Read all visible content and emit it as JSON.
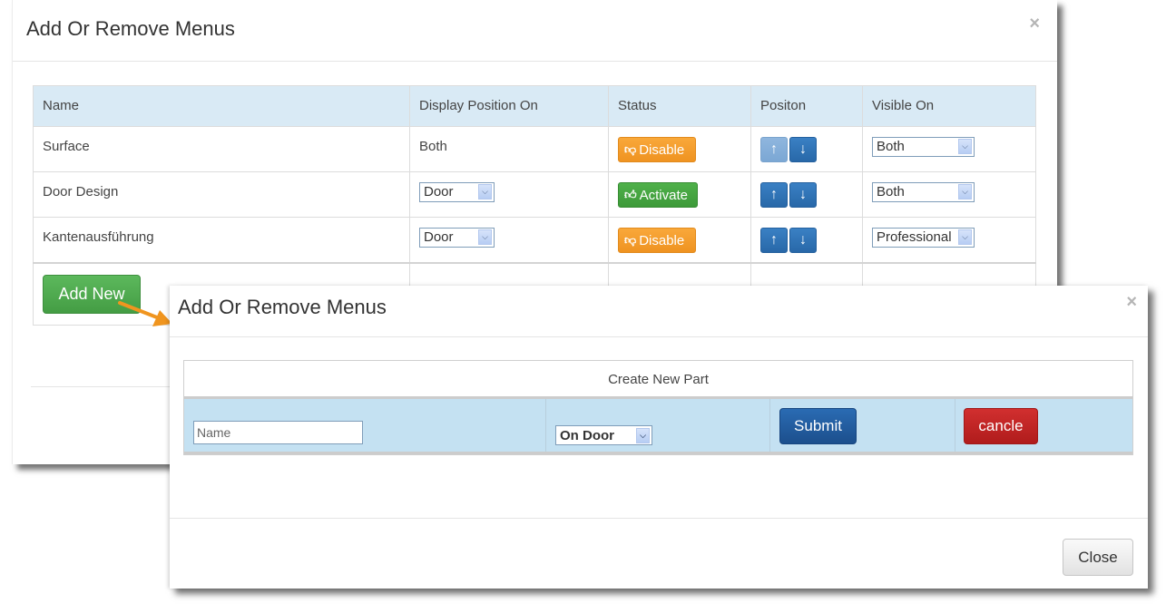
{
  "back_modal": {
    "title": "Add Or Remove Menus",
    "close_glyph": "×",
    "columns": [
      "Name",
      "Display Position On",
      "Status",
      "Positon",
      "Visible On"
    ],
    "rows": [
      {
        "name": "Surface",
        "display_position": "Both",
        "display_position_is_select": false,
        "status": "Disable",
        "status_type": "disable",
        "up_enabled": false,
        "down_enabled": true,
        "visible_on": "Both"
      },
      {
        "name": "Door Design",
        "display_position": "Door",
        "display_position_is_select": true,
        "status": "Activate",
        "status_type": "activate",
        "up_enabled": true,
        "down_enabled": true,
        "visible_on": "Both"
      },
      {
        "name": "Kantenausführung",
        "display_position": "Door",
        "display_position_is_select": true,
        "status": "Disable",
        "status_type": "disable",
        "up_enabled": true,
        "down_enabled": true,
        "visible_on": "Professional"
      }
    ],
    "add_new_label": "Add New",
    "icons": {
      "up": "↑",
      "down": "↓",
      "thumbs_down": "👎",
      "thumbs_up": "👍",
      "dropdown": "⌄"
    }
  },
  "front_modal": {
    "title": "Add Or Remove Menus",
    "close_glyph": "×",
    "table_header": "Create New Part",
    "name_placeholder": "Name",
    "position_select_value": "On Door",
    "submit_label": "Submit",
    "cancel_label": "cancle",
    "close_label": "Close"
  },
  "colors": {
    "header_bg": "#d9eaf5",
    "disable": "#f0962a",
    "activate": "#45a340",
    "arrow_blue": "#2f73b6",
    "add_new": "#4cae4c",
    "submit": "#22599e",
    "cancel": "#c02525",
    "annotation_arrow": "#f0951f"
  }
}
